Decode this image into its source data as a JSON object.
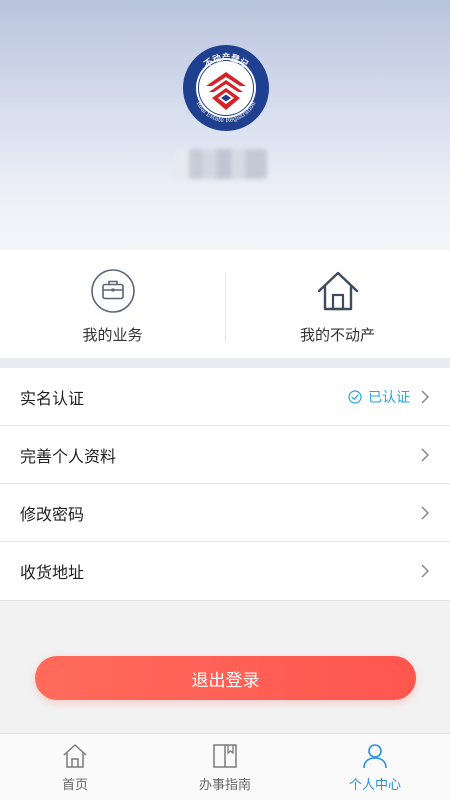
{
  "profile": {
    "logo_text_top": "不动产登记",
    "logo_text_bottom": "Real Estate Registration",
    "username": "●●●●"
  },
  "shortcuts": [
    {
      "label": "我的业务",
      "icon": "briefcase-icon"
    },
    {
      "label": "我的不动产",
      "icon": "house-icon"
    }
  ],
  "menu": {
    "items": [
      {
        "label": "实名认证",
        "status": "已认证"
      },
      {
        "label": "完善个人资料"
      },
      {
        "label": "修改密码"
      },
      {
        "label": "收货地址"
      }
    ]
  },
  "logout_label": "退出登录",
  "tabbar": {
    "items": [
      {
        "label": "首页",
        "icon": "home-icon",
        "active": false
      },
      {
        "label": "办事指南",
        "icon": "book-icon",
        "active": false
      },
      {
        "label": "个人中心",
        "icon": "user-icon",
        "active": true
      }
    ]
  },
  "colors": {
    "accent": "#2b8fe6",
    "verified": "#27a6e0",
    "logout": "#ff5a52",
    "logo_blue": "#1f3f8f",
    "logo_red": "#d4242a"
  }
}
